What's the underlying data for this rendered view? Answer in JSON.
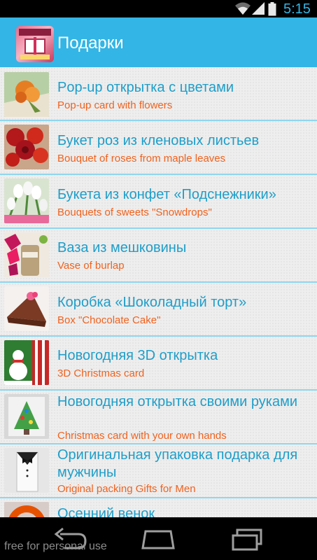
{
  "status_bar": {
    "time": "5:15",
    "icons": [
      "wifi-icon",
      "signal-icon",
      "battery-icon"
    ]
  },
  "app": {
    "title": "Подарки",
    "icon": "gift-box-icon"
  },
  "colors": {
    "accent": "#33b5e5",
    "title_text": "#1e9ec9",
    "subtitle_text": "#f0621e",
    "divider": "#8fd6ee"
  },
  "list": {
    "items": [
      {
        "title": "Pop-up открытка с цветами",
        "subtitle": "Pop-up card with flowers",
        "thumb": "paper-flower-card"
      },
      {
        "title": "Букет роз из кленовых листьев",
        "subtitle": "Bouquet of roses from maple leaves",
        "thumb": "maple-rose-bouquet"
      },
      {
        "title": "Букета из конфет «Подснежники»",
        "subtitle": "Bouquets of sweets \"Snowdrops\"",
        "thumb": "snowdrop-sweets"
      },
      {
        "title": "Ваза из мешковины",
        "subtitle": "Vase of burlap",
        "thumb": "burlap-vase"
      },
      {
        "title": "Коробка «Шоколадный торт»",
        "subtitle": "Box \"Chocolate Cake\"",
        "thumb": "cake-box"
      },
      {
        "title": "Новогодняя 3D открытка",
        "subtitle": "3D Christmas card",
        "thumb": "snowman-card"
      },
      {
        "title": "Новогодняя открытка своими руками",
        "subtitle": "Christmas card with your own hands",
        "thumb": "christmas-tree-card"
      },
      {
        "title": "Оригинальная упаковка подарка для мужчины",
        "subtitle": "Original packing Gifts for Men",
        "thumb": "tuxedo-gift-box"
      },
      {
        "title": "Осенний венок",
        "subtitle": "",
        "thumb": "autumn-wreath"
      }
    ]
  },
  "nav_bar": {
    "buttons": [
      "back-icon",
      "home-icon",
      "recent-apps-icon"
    ]
  },
  "watermark": "free for personal use"
}
